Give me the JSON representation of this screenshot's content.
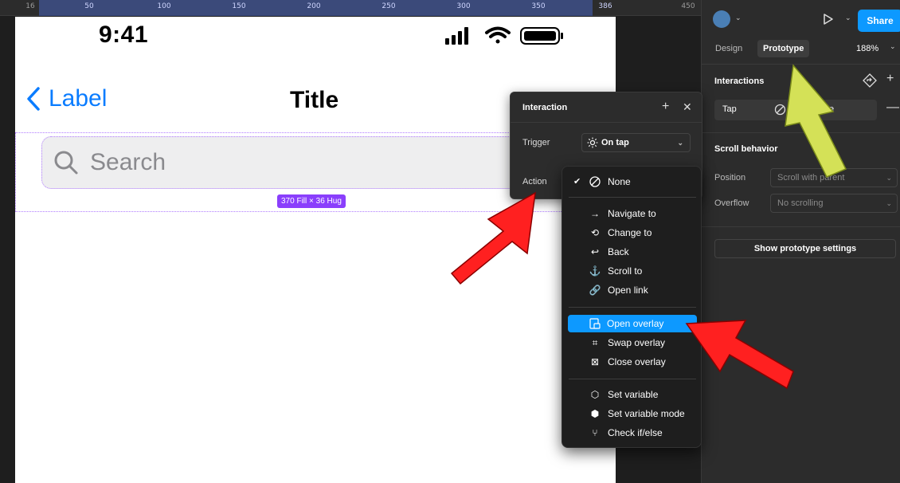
{
  "ruler": {
    "ticks": [
      "16",
      "50",
      "100",
      "150",
      "200",
      "250",
      "300",
      "350",
      "386",
      "450"
    ]
  },
  "phone": {
    "status_time": "9:41",
    "back_label": "Label",
    "title": "Title",
    "search_placeholder": "Search",
    "dimension_badge": "370 Fill × 36 Hug"
  },
  "panel": {
    "share_label": "Share",
    "tabs": [
      "Design",
      "Prototype"
    ],
    "active_tab": "Prototype",
    "zoom": "188%",
    "interactions_title": "Interactions",
    "tap_label": "Tap",
    "tap_value_partial": "e",
    "scroll_title": "Scroll behavior",
    "position_label": "Position",
    "position_value": "Scroll with parent",
    "overflow_label": "Overflow",
    "overflow_value": "No scrolling",
    "show_proto_label": "Show prototype settings"
  },
  "popup": {
    "title": "Interaction",
    "trigger_label": "Trigger",
    "trigger_value": "On tap",
    "action_label": "Action"
  },
  "menu": {
    "group1": [
      {
        "label": "None",
        "icon": "none-icon",
        "checked": true
      }
    ],
    "group2": [
      {
        "label": "Navigate to",
        "icon": "arrow-right-icon"
      },
      {
        "label": "Change to",
        "icon": "swap-icon"
      },
      {
        "label": "Back",
        "icon": "back-icon"
      },
      {
        "label": "Scroll to",
        "icon": "anchor-icon"
      },
      {
        "label": "Open link",
        "icon": "link-icon"
      }
    ],
    "group3": [
      {
        "label": "Open overlay",
        "icon": "open-overlay-icon",
        "highlighted": true
      },
      {
        "label": "Swap overlay",
        "icon": "swap-overlay-icon"
      },
      {
        "label": "Close overlay",
        "icon": "close-overlay-icon"
      }
    ],
    "group4": [
      {
        "label": "Set variable",
        "icon": "variable-icon"
      },
      {
        "label": "Set variable mode",
        "icon": "variable-mode-icon"
      },
      {
        "label": "Check if/else",
        "icon": "conditional-icon"
      }
    ]
  },
  "colors": {
    "accent": "#0d99ff",
    "ios_blue": "#0a7cff",
    "selection_purple": "#8a3ffc",
    "annotation_red": "#ff2020",
    "annotation_yellow": "#d4e157"
  }
}
